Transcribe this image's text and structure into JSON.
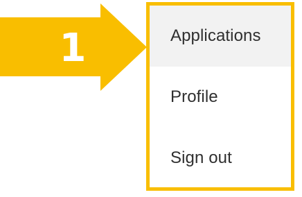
{
  "callout": {
    "step_number": "1",
    "color": "#F9BE00",
    "icon": "arrow-right-icon"
  },
  "menu": {
    "border_color": "#F9BE00",
    "items": [
      {
        "label": "Applications",
        "highlighted": true
      },
      {
        "label": "Profile",
        "highlighted": false
      },
      {
        "label": "Sign out",
        "highlighted": false
      }
    ]
  }
}
